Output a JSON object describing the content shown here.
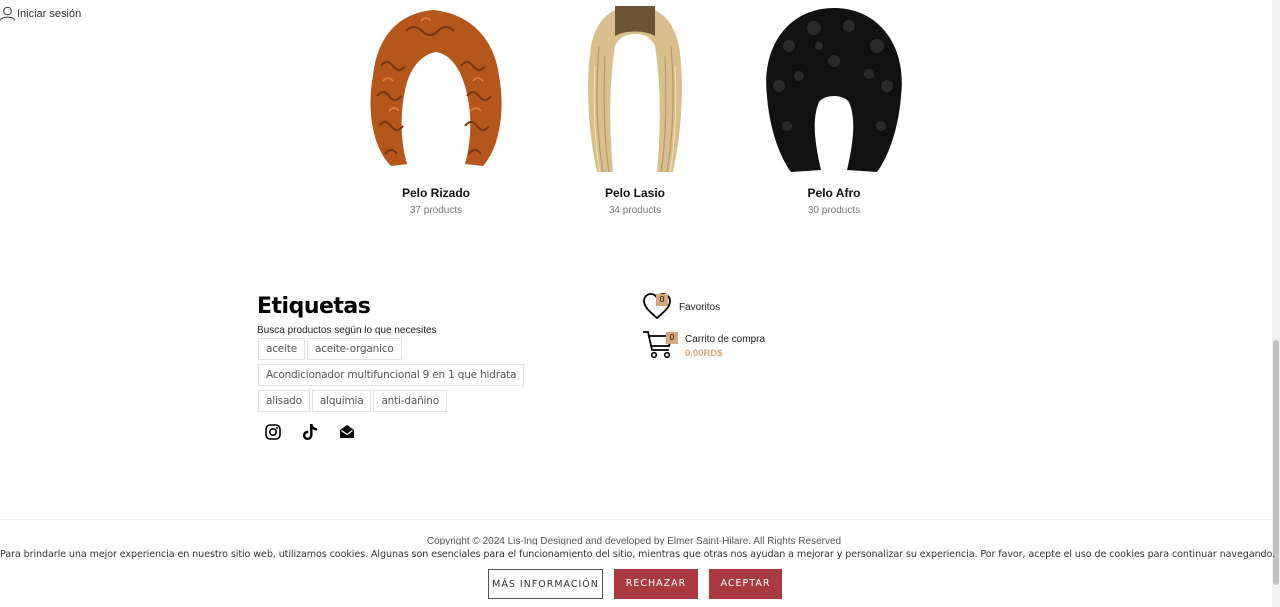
{
  "header": {
    "login_label": "Iniciar sesión"
  },
  "categories": [
    {
      "name": "Pelo Rizado",
      "count": "37 products",
      "hair_color": "#b5561c"
    },
    {
      "name": "Pelo Lasio",
      "count": "34 products",
      "hair_color": "#d9bf8e"
    },
    {
      "name": "Pelo Afro",
      "count": "30 products",
      "hair_color": "#111111"
    }
  ],
  "tags_section": {
    "title": "Etiquetas",
    "subtitle": "Busca productos según lo que necesites",
    "tags": [
      "aceite",
      "aceite-organico",
      "Acondicionador multifuncional 9 en 1 que hidrata",
      "alisado",
      "alquimia",
      "anti-dañino"
    ]
  },
  "social": [
    {
      "icon": "instagram-icon"
    },
    {
      "icon": "tiktok-icon"
    },
    {
      "icon": "mail-icon"
    }
  ],
  "favorites": {
    "count": "0",
    "label": "Favoritos"
  },
  "cart": {
    "count": "0",
    "label": "Carrito de compra",
    "total": "0.00RD$"
  },
  "footer": {
    "copyright": "Copyright © 2024 Lis-Ing Designed and developed by Elmer Saint-Hilare. All Rights Reserved"
  },
  "cookie_banner": {
    "text": "Para brindarle una mejor experiencia en nuestro sitio web, utilizamos cookies. Algunas son esenciales para el funcionamiento del sitio, mientras que otras nos ayudan a mejorar y personalizar su experiencia. Por favor, acepte el uso de cookies para continuar navegando.",
    "more_info_label": "MÁS INFORMACIÓN",
    "reject_label": "RECHAZAR",
    "accept_label": "ACEPTAR"
  },
  "colors": {
    "accent_gold": "#d6a77a",
    "button_red": "#a93a3f"
  }
}
